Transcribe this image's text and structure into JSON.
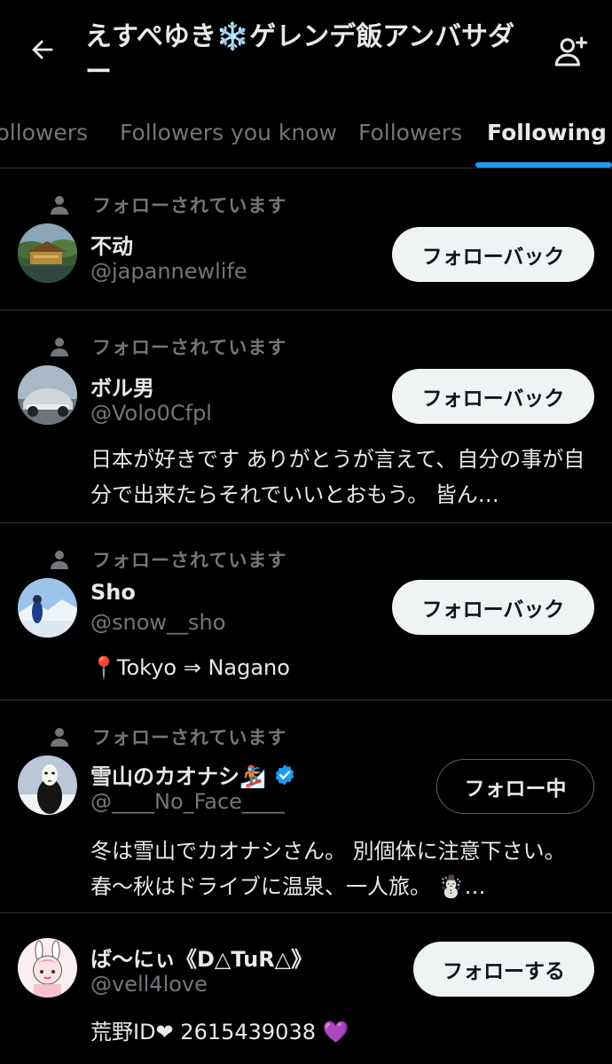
{
  "header": {
    "title": "えすぺゆき❄️ゲレンデ飯アンバサダー",
    "back_icon": "arrow-left-icon",
    "add_user_icon": "person-add-icon"
  },
  "tabs": [
    {
      "label": "Followers",
      "active": false
    },
    {
      "label": "Followers you know",
      "active": false
    },
    {
      "label": "Followers",
      "active": false
    },
    {
      "label": "Following",
      "active": true
    }
  ],
  "colors": {
    "accent": "#1d9bf0",
    "background": "#000000",
    "muted_text": "#71767b",
    "divider": "#2f3336"
  },
  "users": [
    {
      "follows_you": "フォローされています",
      "name": "不动",
      "handle": "@japannewlife",
      "bio": "",
      "button": "フォローバック",
      "verified": false
    },
    {
      "follows_you": "フォローされています",
      "name": "ボル男",
      "handle": "@Volo0Cfpl",
      "bio": "日本が好きです ありがとうが言えて、自分の事が自分で出来たらそれでいいとおもう。 皆ん…",
      "button": "フォローバック",
      "verified": false
    },
    {
      "follows_you": "フォローされています",
      "name": "Sho",
      "handle": "@snow__sho",
      "bio": "📍Tokyo ⇒ Nagano",
      "button": "フォローバック",
      "verified": false
    },
    {
      "follows_you": "フォローされています",
      "name": "雪山のカオナシ🏂",
      "handle": "@____No_Face____",
      "bio": "冬は雪山でカオナシさん。 別個体に注意下さい。春〜秋はドライブに温泉、一人旅。 ☃️…",
      "button": "フォロー中",
      "verified": true
    },
    {
      "follows_you": "",
      "name": "ば〜にぃ《D△TuR△》",
      "handle": "@vell4love",
      "bio": "荒野ID❤ 2615439038 💜",
      "button": "フォローする",
      "verified": false
    }
  ]
}
